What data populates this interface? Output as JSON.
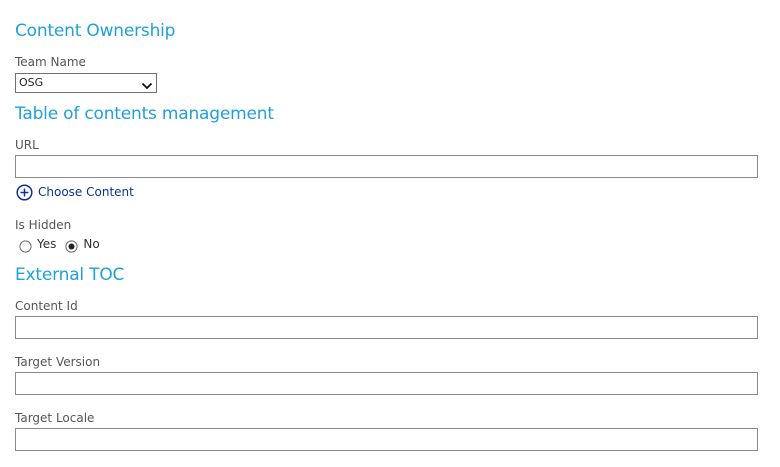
{
  "content_ownership": {
    "title": "Content Ownership",
    "team_name_label": "Team Name",
    "team_name_value": "OSG"
  },
  "toc_management": {
    "title": "Table of contents management",
    "url_label": "URL",
    "url_value": "",
    "choose_content_label": "Choose Content",
    "is_hidden_label": "Is Hidden",
    "is_hidden_options": [
      {
        "label": "Yes",
        "selected": false
      },
      {
        "label": "No",
        "selected": true
      }
    ]
  },
  "external_toc": {
    "title": "External TOC",
    "content_id_label": "Content Id",
    "content_id_value": "",
    "target_version_label": "Target Version",
    "target_version_value": "",
    "target_locale_label": "Target Locale",
    "target_locale_value": ""
  },
  "colors": {
    "section_title": "#1fa1da",
    "link": "#0f2f94",
    "input_border": "#8a8a8a"
  },
  "icons": {
    "dropdown": "chevron-down-icon",
    "add": "plus-circle-icon",
    "radio": "radio-button-icon"
  }
}
